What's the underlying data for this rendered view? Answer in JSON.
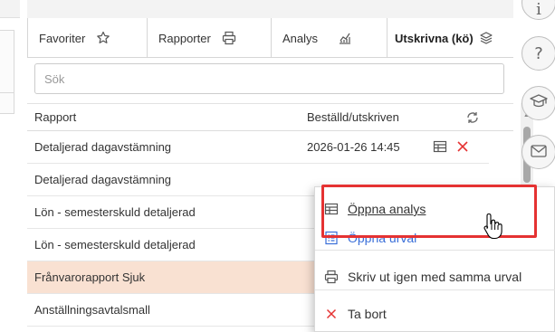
{
  "tabs": [
    {
      "label": "Favoriter",
      "icon": "star-icon"
    },
    {
      "label": "Rapporter",
      "icon": "printer-icon"
    },
    {
      "label": "Analys",
      "icon": "chart-icon"
    },
    {
      "label": "Utskrivna (kö)",
      "icon": "stack-icon"
    }
  ],
  "search": {
    "placeholder": "Sök",
    "value": ""
  },
  "table": {
    "columns": [
      "Rapport",
      "Beställd/utskriven"
    ],
    "rows": [
      {
        "name": "Detaljerad dagavstämning",
        "date": "2026-01-26 14:45"
      },
      {
        "name": "Detaljerad dagavstämning",
        "date": ""
      },
      {
        "name": "Lön - semesterskuld detaljerad",
        "date": ""
      },
      {
        "name": "Lön - semesterskuld detaljerad",
        "date": ""
      },
      {
        "name": "Frånvarorapport Sjuk",
        "date": ""
      },
      {
        "name": "Anställningsavtalsmall",
        "date": ""
      }
    ]
  },
  "rail": [
    {
      "glyph": "i",
      "icon": "info-icon"
    },
    {
      "glyph": "?",
      "icon": "help-icon"
    },
    {
      "glyph": "",
      "icon": "graduation-cap-icon"
    },
    {
      "glyph": "",
      "icon": "mail-icon"
    }
  ],
  "context_menu": {
    "items": [
      {
        "label": "Öppna analys",
        "icon": "table-icon"
      },
      {
        "label": "Öppna urval",
        "icon": "list-icon"
      },
      {
        "label": "Skriv ut igen med samma urval",
        "icon": "printer-icon"
      },
      {
        "label": "Ta bort",
        "icon": "close-icon"
      }
    ]
  },
  "colors": {
    "highlight_row": "#f9e1d2",
    "accent_blue": "#3a6fd8",
    "delete_red": "#e53232",
    "focus_box": "#e53232"
  }
}
